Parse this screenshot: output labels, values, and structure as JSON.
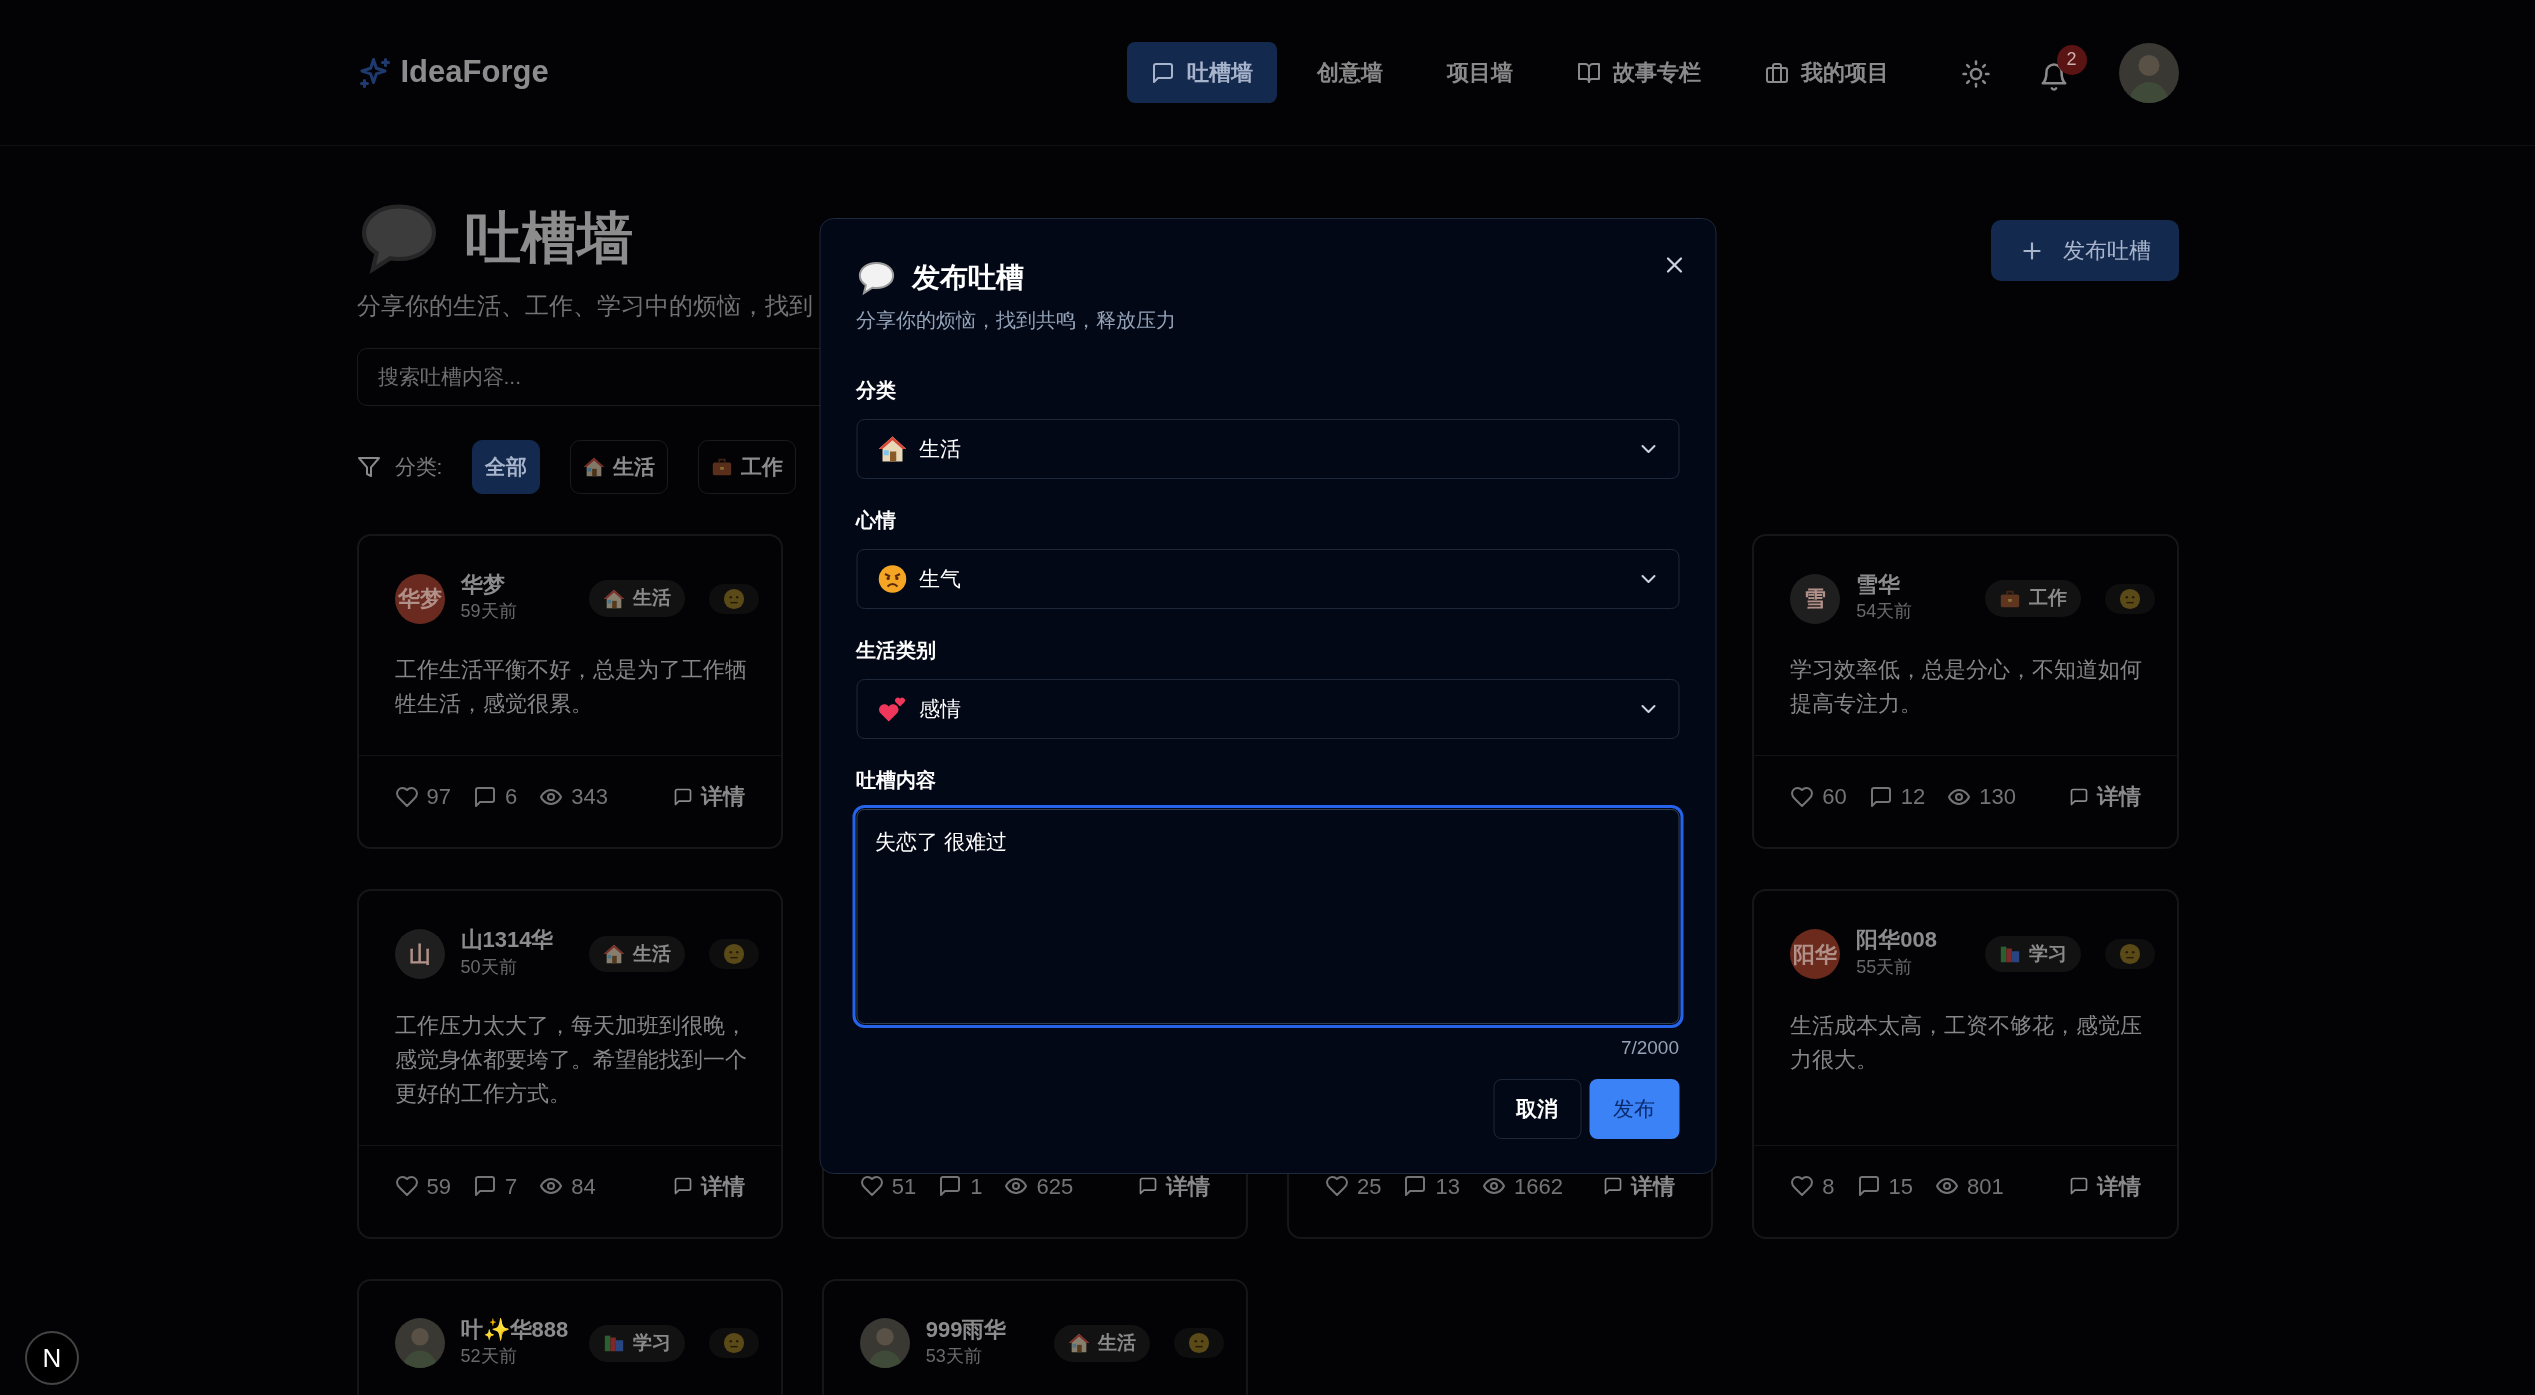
{
  "header": {
    "logo": "IdeaForge",
    "nav": [
      {
        "label": "吐槽墙",
        "kind": "chat",
        "selected": true
      },
      {
        "label": "创意墙",
        "kind": "plain",
        "selected": false
      },
      {
        "label": "项目墙",
        "kind": "plain",
        "selected": false
      },
      {
        "label": "故事专栏",
        "kind": "book",
        "selected": false
      },
      {
        "label": "我的项目",
        "kind": "briefcase",
        "selected": false
      }
    ],
    "notification_count": "2"
  },
  "page": {
    "title": "吐槽墙",
    "subtitle": "分享你的生活、工作、学习中的烦恼，找到",
    "publish_button": "发布吐槽",
    "search": {
      "placeholder": "搜索吐槽内容..."
    },
    "filter": {
      "label": "分类:",
      "chips": [
        {
          "label": "全部",
          "kind": "plain",
          "selected": true
        },
        {
          "label": "生活",
          "kind": "home",
          "selected": false
        },
        {
          "label": "工作",
          "kind": "work",
          "selected": false
        }
      ]
    }
  },
  "cards": [
    {
      "author": "华梦",
      "avatar_text": "华梦",
      "color": "#6b2a20",
      "time": "59天前",
      "category": {
        "label": "生活",
        "kind": "home"
      },
      "content": "工作生活平衡不好，总是为了工作牺牲生活，感觉很累。",
      "likes": "97",
      "comments": "6",
      "views": "343",
      "details": "详情"
    },
    {
      "author": "雪华",
      "avatar_text": "雪",
      "color": "#1f1f1f",
      "time": "54天前",
      "category": {
        "label": "工作",
        "kind": "work"
      },
      "content": "学习效率低，总是分心，不知道如何提高专注力。",
      "likes": "60",
      "comments": "12",
      "views": "130",
      "details": "详情"
    },
    {
      "author": "山1314华",
      "avatar_text": "山",
      "color": "#1f1f1f",
      "time": "50天前",
      "category": {
        "label": "生活",
        "kind": "home"
      },
      "content": "工作压力太大了，每天加班到很晚，感觉身体都要垮了。希望能找到一个更好的工作方式。",
      "likes": "59",
      "comments": "7",
      "views": "84",
      "details": "详情"
    },
    {
      "likes": "51",
      "comments": "1",
      "views": "625",
      "details": "详情"
    },
    {
      "likes": "25",
      "comments": "13",
      "views": "1662",
      "details": "详情"
    },
    {
      "author": "阳华008",
      "avatar_text": "阳华",
      "color": "#6b2a1c",
      "time": "55天前",
      "category": {
        "label": "学习",
        "kind": "study"
      },
      "content": "生活成本太高，工资不够花，感觉压力很大。",
      "likes": "8",
      "comments": "15",
      "views": "801",
      "details": "详情"
    },
    {
      "author": "叶✨华888",
      "time": "52天前",
      "category": {
        "label": "学习",
        "kind": "study"
      }
    },
    {
      "author": "999雨华",
      "time": "53天前",
      "category": {
        "label": "生活",
        "kind": "home"
      }
    }
  ],
  "dialog": {
    "title": "发布吐槽",
    "subtitle": "分享你的烦恼，找到共鸣，释放压力",
    "fields": [
      {
        "label": "分类",
        "value": "生活",
        "kind": "home"
      },
      {
        "label": "心情",
        "value": "生气",
        "kind": "angry"
      },
      {
        "label": "生活类别",
        "value": "感情",
        "kind": "hearts"
      }
    ],
    "content_label": "吐槽内容",
    "content_value": "失恋了 很难过",
    "counter": "7/2000",
    "buttons": [
      {
        "label": "取消",
        "kind": "secondary"
      },
      {
        "label": "发布",
        "kind": "primary"
      }
    ]
  },
  "dev_badge": "N"
}
